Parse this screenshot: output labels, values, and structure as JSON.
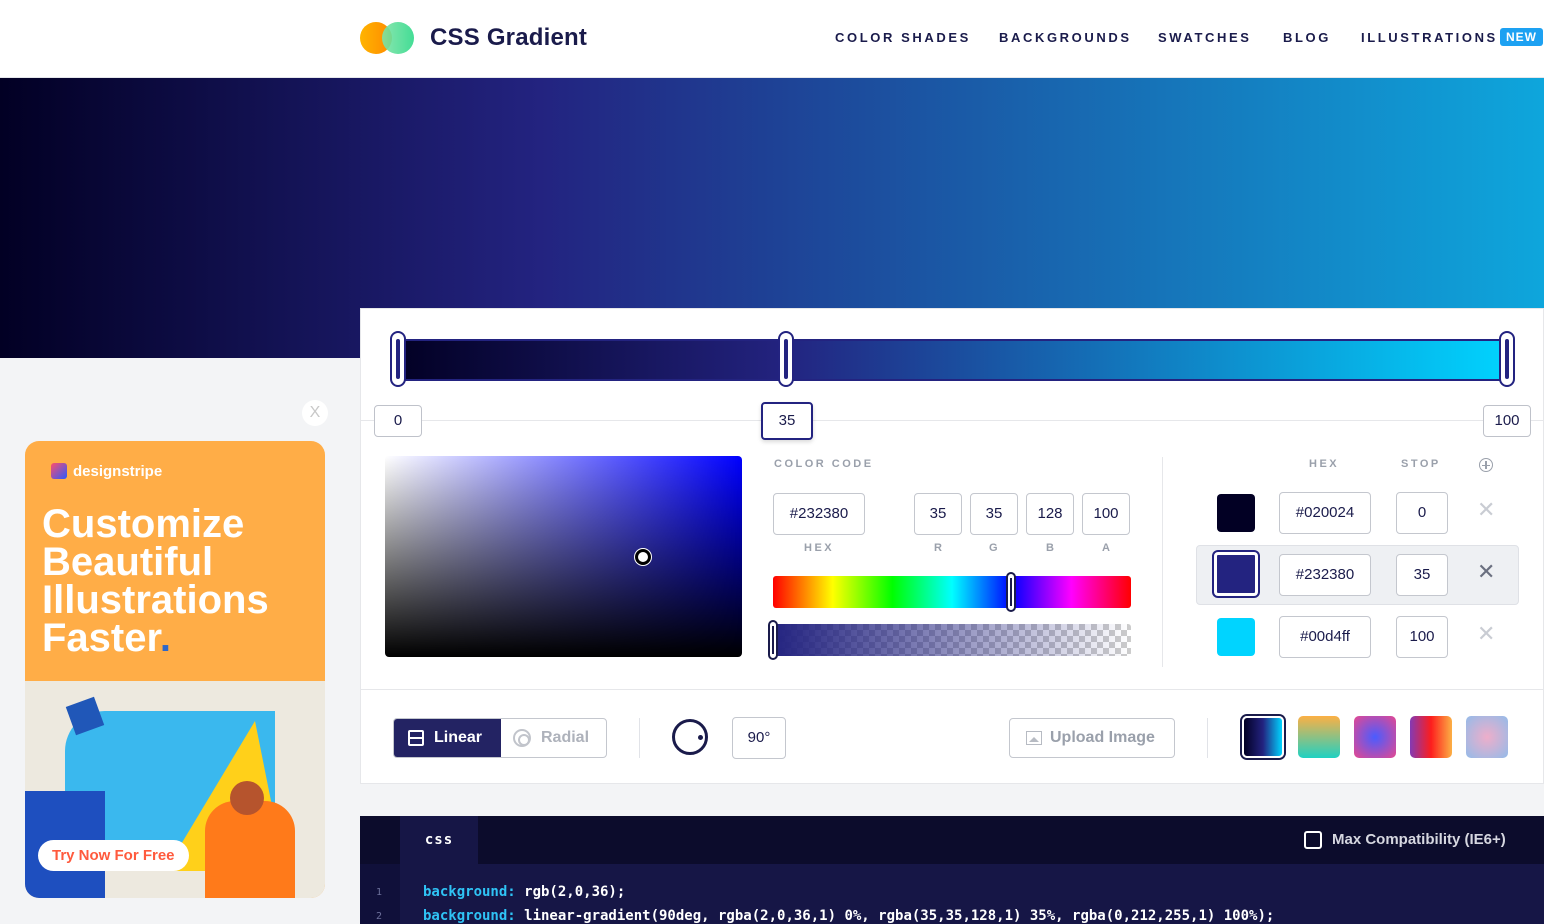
{
  "header": {
    "brand": "CSS Gradient",
    "nav": [
      "COLOR SHADES",
      "BACKGROUNDS",
      "SWATCHES",
      "BLOG",
      "ILLUSTRATIONS"
    ],
    "new_badge": "NEW"
  },
  "ad": {
    "close": "X",
    "brand": "designstripe",
    "headline": "Customize Beautiful Illustrations Faster",
    "headline_dot": ".",
    "cta": "Try Now For Free"
  },
  "gradient": {
    "stops_inputs": [
      "0",
      "35",
      "100"
    ],
    "active_stop": "35",
    "colors": {
      "start": "#020024",
      "mid": "#232380",
      "end": "#00d4ff"
    }
  },
  "color_code": {
    "title": "COLOR CODE",
    "hex": "#232380",
    "r": "35",
    "g": "35",
    "b": "128",
    "a": "100",
    "labels": {
      "hex": "HEX",
      "r": "R",
      "g": "G",
      "b": "B",
      "a": "A"
    }
  },
  "stops_table": {
    "col_hex": "HEX",
    "col_stop": "STOP",
    "add_icon": "add-stop-icon",
    "rows": [
      {
        "hex": "#020024",
        "stop": "0",
        "color": "#020024"
      },
      {
        "hex": "#232380",
        "stop": "35",
        "color": "#232380"
      },
      {
        "hex": "#00d4ff",
        "stop": "100",
        "color": "#00d4ff"
      }
    ],
    "remove": "✕"
  },
  "controls": {
    "linear": "Linear",
    "radial": "Radial",
    "angle": "90°",
    "upload": "Upload Image"
  },
  "code": {
    "tab": "css",
    "max_compat": "Max Compatibility (IE6+)",
    "lines": [
      {
        "num": "1",
        "prop": "background:",
        "value": " rgb(2,0,36);"
      },
      {
        "num": "2",
        "prop": "background:",
        "value": " linear-gradient(90deg, rgba(2,0,36,1) 0%, rgba(35,35,128,1) 35%, rgba(0,212,255,1) 100%);"
      }
    ]
  }
}
